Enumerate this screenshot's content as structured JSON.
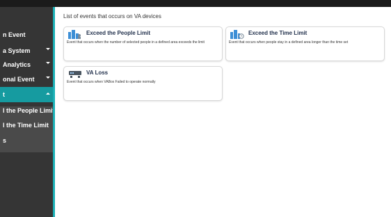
{
  "sidebar": {
    "items": [
      {
        "label": "n Event"
      },
      {
        "label": "a System"
      },
      {
        "label": "Analytics"
      },
      {
        "label": "onal Event"
      },
      {
        "label": "t"
      }
    ],
    "subitems": [
      {
        "label": "l the People Limit"
      },
      {
        "label": "l the Time Limit"
      },
      {
        "label": "s"
      }
    ]
  },
  "main": {
    "title": "List of events that occurs on VA devices",
    "cards": [
      {
        "title": "Exceed the People Limit",
        "description": "Event that occurs when the number of selected people in a defined area exceeds the limit",
        "icon": "people-limit-icon"
      },
      {
        "title": "Exceed the Time Limit",
        "description": "Event that occurs when people stay in a defined area longer than the time set",
        "icon": "time-limit-icon"
      },
      {
        "title": "VA Loss",
        "description": "Event that occurs when VABox Failed to operate normally",
        "icon": "device-loss-icon"
      }
    ]
  },
  "colors": {
    "accent": "#1ab0b6",
    "sidebar_bg": "#353535",
    "active_item": "#169ba0",
    "icon_blue": "#3d8fd6"
  }
}
